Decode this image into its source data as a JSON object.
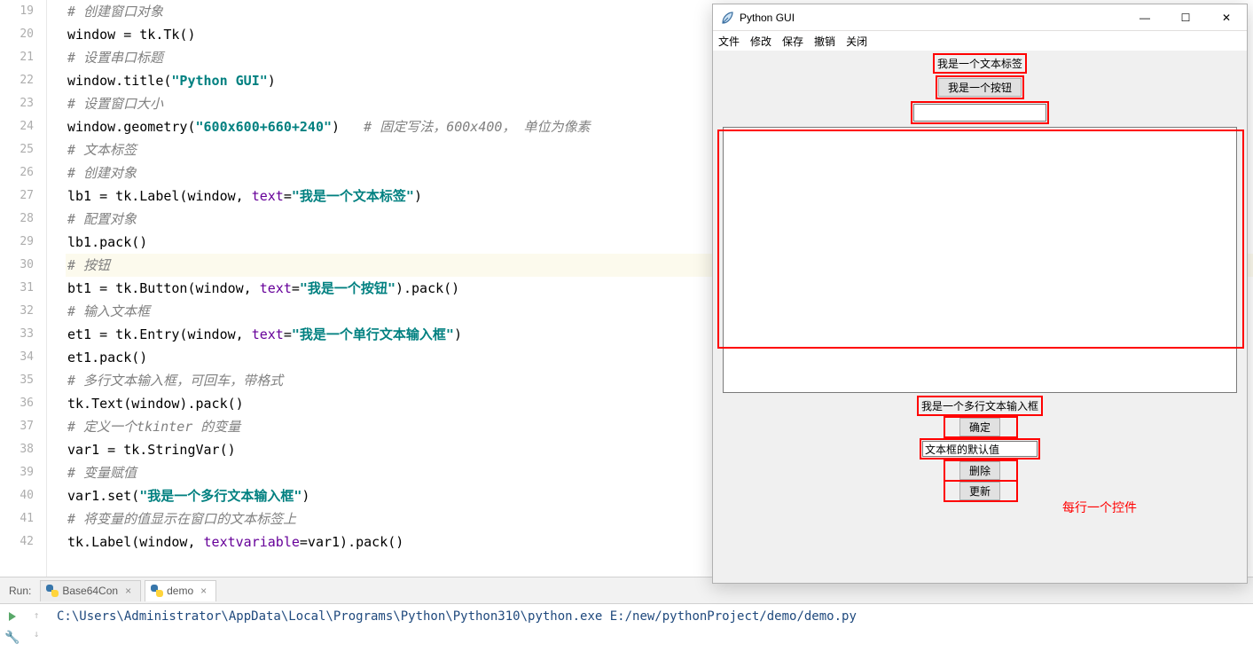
{
  "gutter_start": 19,
  "code_lines": [
    {
      "segments": [
        {
          "cls": "cm",
          "t": "# 创建窗口对象"
        }
      ]
    },
    {
      "segments": [
        {
          "cls": "",
          "t": "window = tk.Tk()"
        }
      ]
    },
    {
      "segments": [
        {
          "cls": "cm",
          "t": "# 设置串口标题"
        }
      ]
    },
    {
      "segments": [
        {
          "cls": "",
          "t": "window.title("
        },
        {
          "cls": "str",
          "t": "\"Python GUI\""
        },
        {
          "cls": "",
          "t": ")"
        }
      ]
    },
    {
      "segments": [
        {
          "cls": "cm",
          "t": "# 设置窗口大小"
        }
      ]
    },
    {
      "segments": [
        {
          "cls": "",
          "t": "window.geometry("
        },
        {
          "cls": "str",
          "t": "\"600x600+660+240\""
        },
        {
          "cls": "",
          "t": ")   "
        },
        {
          "cls": "cm",
          "t": "# 固定写法，600x400， 单位为像素"
        }
      ]
    },
    {
      "segments": [
        {
          "cls": "cm",
          "t": "# 文本标签"
        }
      ],
      "tick": true
    },
    {
      "segments": [
        {
          "cls": "cm",
          "t": "# 创建对象"
        }
      ],
      "tick": true
    },
    {
      "segments": [
        {
          "cls": "",
          "t": "lb1 = tk.Label(window, "
        },
        {
          "cls": "arg",
          "t": "text"
        },
        {
          "cls": "",
          "t": "="
        },
        {
          "cls": "str",
          "t": "\"我是一个文本标签\""
        },
        {
          "cls": "",
          "t": ")"
        }
      ]
    },
    {
      "segments": [
        {
          "cls": "cm",
          "t": "# 配置对象"
        }
      ]
    },
    {
      "segments": [
        {
          "cls": "",
          "t": "lb1.pack()"
        }
      ]
    },
    {
      "segments": [
        {
          "cls": "cm",
          "t": "# 按钮"
        }
      ],
      "highlight": true
    },
    {
      "segments": [
        {
          "cls": "",
          "t": "bt1 = tk.Button(window, "
        },
        {
          "cls": "arg",
          "t": "text"
        },
        {
          "cls": "",
          "t": "="
        },
        {
          "cls": "str",
          "t": "\"我是一个按钮\""
        },
        {
          "cls": "",
          "t": ").pack()"
        }
      ]
    },
    {
      "segments": [
        {
          "cls": "cm",
          "t": "# 输入文本框"
        }
      ]
    },
    {
      "segments": [
        {
          "cls": "",
          "t": "et1 = tk.Entry(window, "
        },
        {
          "cls": "arg",
          "t": "text"
        },
        {
          "cls": "",
          "t": "="
        },
        {
          "cls": "str",
          "t": "\"我是一个单行文本输入框\""
        },
        {
          "cls": "",
          "t": ")"
        }
      ]
    },
    {
      "segments": [
        {
          "cls": "",
          "t": "et1.pack()"
        }
      ]
    },
    {
      "segments": [
        {
          "cls": "cm",
          "t": "# 多行文本输入框，可回车，带格式"
        }
      ]
    },
    {
      "segments": [
        {
          "cls": "",
          "t": "tk.Text(window).pack()"
        }
      ]
    },
    {
      "segments": [
        {
          "cls": "cm",
          "t": "# 定义一个tkinter 的变量"
        }
      ]
    },
    {
      "segments": [
        {
          "cls": "",
          "t": "var1 = tk.StringVar()"
        }
      ]
    },
    {
      "segments": [
        {
          "cls": "cm",
          "t": "# 变量赋值"
        }
      ]
    },
    {
      "segments": [
        {
          "cls": "",
          "t": "var1.set("
        },
        {
          "cls": "str",
          "t": "\"我是一个多行文本输入框\""
        },
        {
          "cls": "",
          "t": ")"
        }
      ]
    },
    {
      "segments": [
        {
          "cls": "cm",
          "t": "# 将变量的值显示在窗口的文本标签上"
        }
      ]
    },
    {
      "segments": [
        {
          "cls": "",
          "t": "tk.Label(window, "
        },
        {
          "cls": "arg",
          "t": "textvariable"
        },
        {
          "cls": "",
          "t": "=var1).pack()"
        }
      ]
    }
  ],
  "run": {
    "label": "Run:",
    "tabs": [
      {
        "name": "Base64Con",
        "active": false
      },
      {
        "name": "demo",
        "active": true
      }
    ],
    "output": "C:\\Users\\Administrator\\AppData\\Local\\Programs\\Python\\Python310\\python.exe E:/new/pythonProject/demo/demo.py"
  },
  "tk": {
    "title": "Python GUI",
    "menu": [
      "文件",
      "修改",
      "保存",
      "撤销",
      "关闭"
    ],
    "label1": "我是一个文本标签",
    "button1": "我是一个按钮",
    "label_multiline": "我是一个多行文本输入框",
    "btn_ok": "确定",
    "entry_default": "文本框的默认值",
    "btn_delete": "删除",
    "btn_update": "更新",
    "annotation": "每行一个控件"
  }
}
